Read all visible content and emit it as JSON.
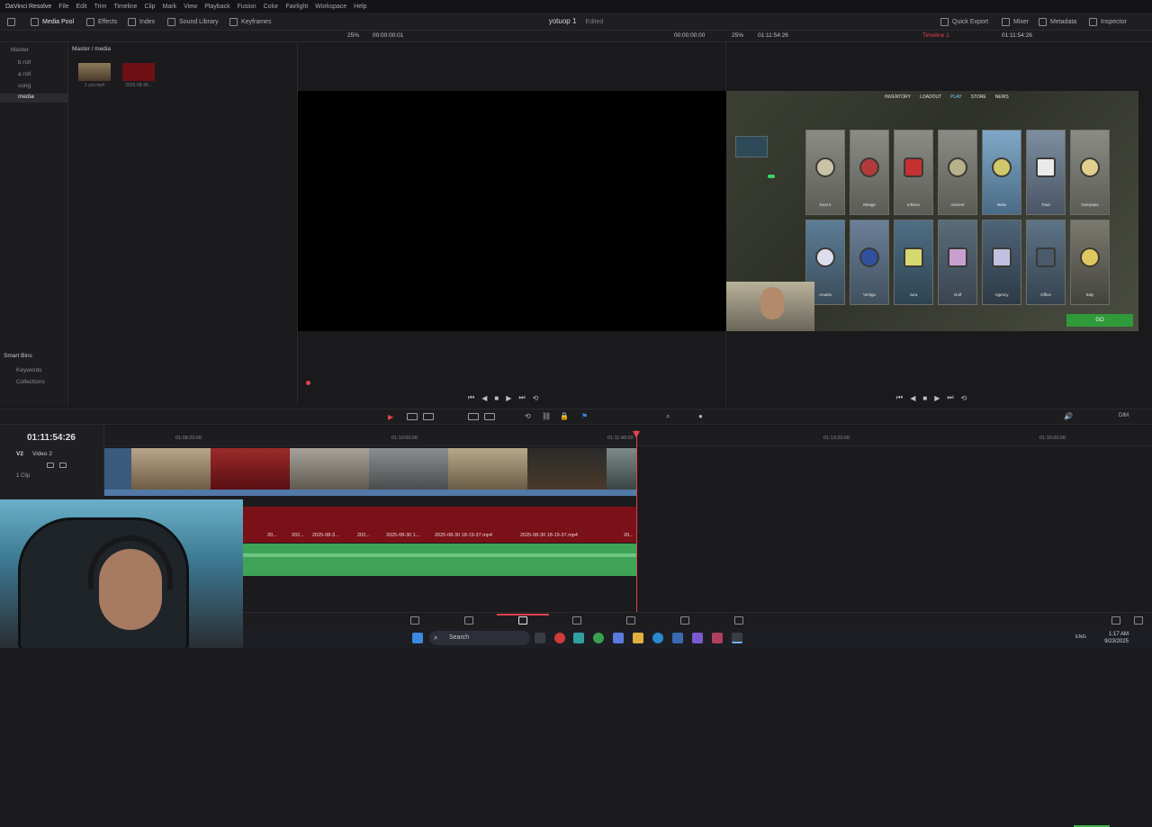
{
  "menu": {
    "app_name": "DaVinci Resolve",
    "items": [
      "File",
      "Edit",
      "Trim",
      "Timeline",
      "Clip",
      "Mark",
      "View",
      "Playback",
      "Fusion",
      "Color",
      "Fairlight",
      "Workspace",
      "Help"
    ]
  },
  "toolbar": {
    "media_pool": "Media Pool",
    "effects": "Effects",
    "index": "Index",
    "sound_library": "Sound Library",
    "keyframes": "Keyframes",
    "project_title": "yotuop 1",
    "edited": "Edited",
    "quick_export": "Quick Export",
    "mixer": "Mixer",
    "metadata": "Metadata",
    "inspector": "Inspector"
  },
  "source_viewer": {
    "zoom": "25%",
    "timecode": "00:00:00:01",
    "right_timecode": "00:00:00:00"
  },
  "program_viewer": {
    "zoom": "25%",
    "timecode": "01:11:54:26",
    "timeline_name": "Timeline 1",
    "right_timecode": "01:11:54:26"
  },
  "bins": {
    "root": "Master",
    "items": [
      "b roll",
      "a roll",
      "song",
      "media"
    ],
    "selected": "media"
  },
  "pool": {
    "breadcrumb": "Master / media",
    "clips": [
      "1 yot.mp4",
      "2025-08-30..."
    ]
  },
  "smart_bins": {
    "title": "Smart Bins",
    "items": [
      "Keywords",
      "Collections"
    ]
  },
  "game_ui": {
    "tabs": [
      "INVENTORY",
      "LOADOUT",
      "PLAY",
      "STORE",
      "NEWS"
    ],
    "maps_row1": [
      "Dust II",
      "Mirage",
      "Inferno",
      "Ancient",
      "Nuke",
      "Train",
      "Overpass"
    ],
    "maps_row2": [
      "Anubis",
      "Vertigo",
      "Jura",
      "Golf",
      "Agency",
      "Office",
      "Italy"
    ],
    "go_button": "GO"
  },
  "timeline": {
    "timecode": "01:11:54:26",
    "track_v2": "V2",
    "track_name": "Video 2",
    "clip_count": "1 Clip",
    "ruler": [
      "01:08:20:00",
      "01:10:00:00",
      "01:11:40:00",
      "01:13:20:00",
      "01:15:00:00"
    ],
    "audio_labels": [
      "20...",
      "202...",
      "2025-08-3...",
      "202...",
      "2025-08-30 1...",
      "2025-08-30 18-19-37.mp4",
      "2025-08-30 18-19-37.mp4",
      "20..."
    ]
  },
  "audio": {
    "dim": "DIM"
  },
  "taskbar": {
    "search": "Search",
    "lang": "ENG",
    "time": "1:17 AM",
    "date": "9/23/2025"
  },
  "colors": {
    "accent_red": "#e0414a",
    "video_clip": "#3b5a7e",
    "audio_green": "#3ea357",
    "audio_red": "#7a1118"
  }
}
